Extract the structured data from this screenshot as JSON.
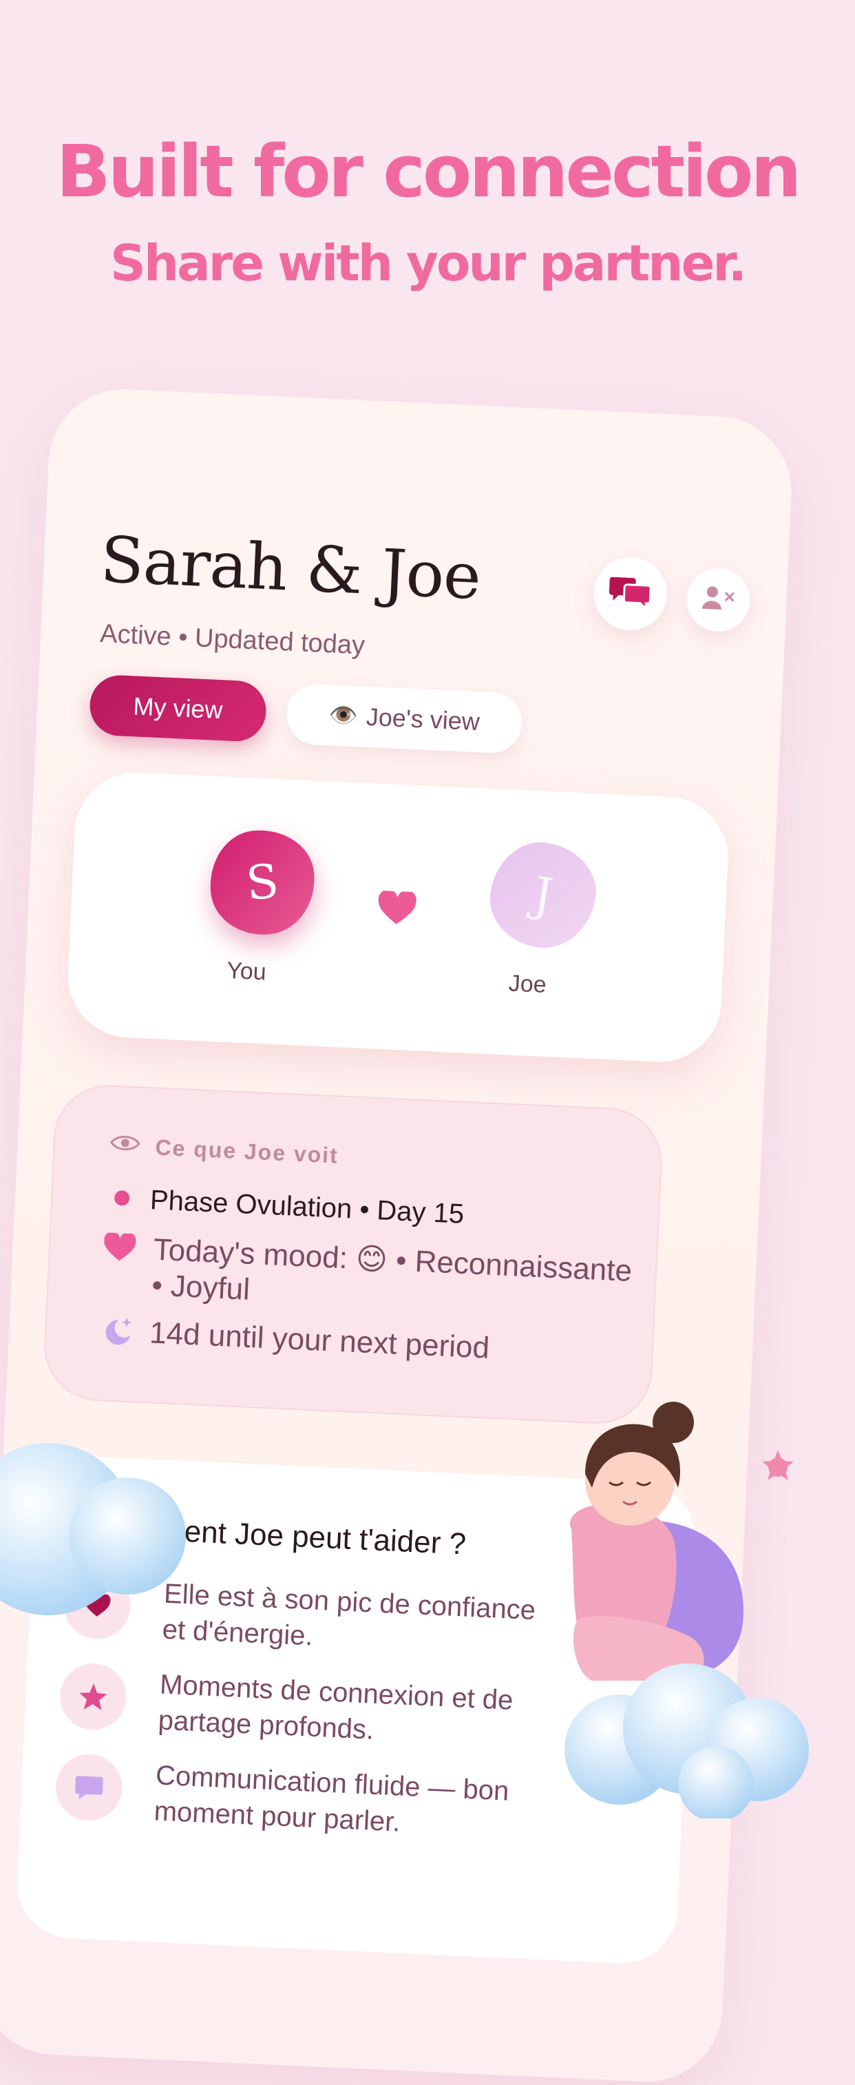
{
  "hero": {
    "title": "Built for connection",
    "subtitle": "Share with your partner."
  },
  "header": {
    "names": "Sarah & Joe",
    "status": "Active • Updated today",
    "icons": {
      "chat": "chat-bubbles-icon",
      "unlink": "remove-partner-icon"
    }
  },
  "tabs": {
    "my_view": "My view",
    "joe_view_icon": "👁️",
    "joe_view": "Joe's view"
  },
  "couple": {
    "you_initial": "S",
    "you_label": "You",
    "partner_initial": "J",
    "partner_label": "Joe"
  },
  "partner_view": {
    "heading": "Ce que Joe voit",
    "phase": "Phase Ovulation • Day 15",
    "mood": "Today's mood: 😊 • Reconnaissante • Joyful",
    "period": "14d until your next period"
  },
  "help": {
    "title": "Comment Joe peut t'aider ?",
    "items": [
      {
        "icon": "heart-icon",
        "text": "Elle est à son pic de confiance et d'énergie."
      },
      {
        "icon": "star-icon",
        "text": "Moments de connexion et de partage profonds."
      },
      {
        "icon": "speech-bubble-icon",
        "text": "Communication fluide — bon moment pour parler."
      }
    ]
  },
  "colors": {
    "background": "#f9e6ee",
    "accent": "#f06aa0",
    "primary": "#c2185b",
    "partner_avatar": "#e9c8ef"
  }
}
